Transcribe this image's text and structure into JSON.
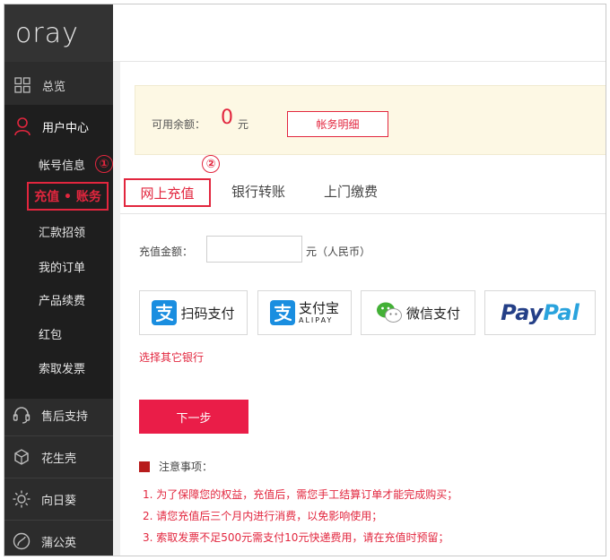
{
  "logo": "oray",
  "sidebar": {
    "overview": "总览",
    "user_center": "用户中心",
    "sub_items": [
      "帐号信息",
      "充值 • 账务",
      "汇款招领",
      "我的订单",
      "产品续费",
      "红包",
      "索取发票"
    ],
    "annotation_1": "①",
    "bottom_items": [
      "售后支持",
      "花生壳",
      "向日葵",
      "蒲公英"
    ]
  },
  "balance": {
    "label": "可用余额：",
    "value": "0",
    "unit": "元",
    "detail_button": "帐务明细"
  },
  "tabs": {
    "annotation_2": "②",
    "items": [
      "网上充值",
      "银行转账",
      "上门缴费"
    ],
    "active_index": 0
  },
  "amount": {
    "label": "充值金额：",
    "value": "",
    "unit": "元（人民币）"
  },
  "payment_methods": [
    {
      "name": "扫码支付",
      "icon": "alipay-icon"
    },
    {
      "name": "支付宝",
      "sub": "ALIPAY",
      "icon": "alipay-icon"
    },
    {
      "name": "微信支付",
      "icon": "wechat-icon"
    },
    {
      "name": "PayPal",
      "icon": "paypal-logo"
    }
  ],
  "other_bank": "选择其它银行",
  "next_button": "下一步",
  "notice": {
    "title": "注意事项：",
    "items": [
      "1. 为了保障您的权益，充值后，需您手工结算订单才能完成购买；",
      "2. 请您充值后三个月内进行消费，以免影响使用；",
      "3. 索取发票不足500元需支付10元快递费用，请在充值时预留；"
    ]
  },
  "colors": {
    "accent": "#e2263e",
    "sidebar": "#2c2c2c",
    "next_button": "#ea1d48",
    "alipay_blue": "#1a8ee0"
  }
}
